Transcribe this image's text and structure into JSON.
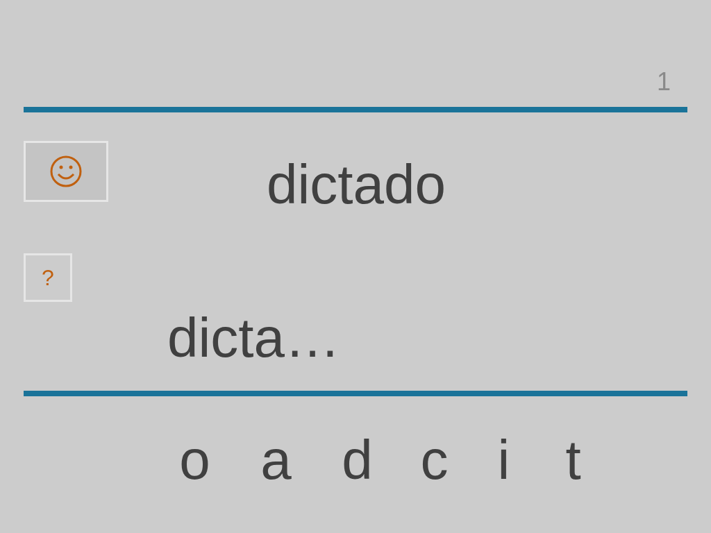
{
  "page_number": "1",
  "word": "dictado",
  "help_button": {
    "label": "?"
  },
  "answer": "dicta…",
  "letters": [
    "o",
    "a",
    "d",
    "c",
    "i",
    "t"
  ]
}
